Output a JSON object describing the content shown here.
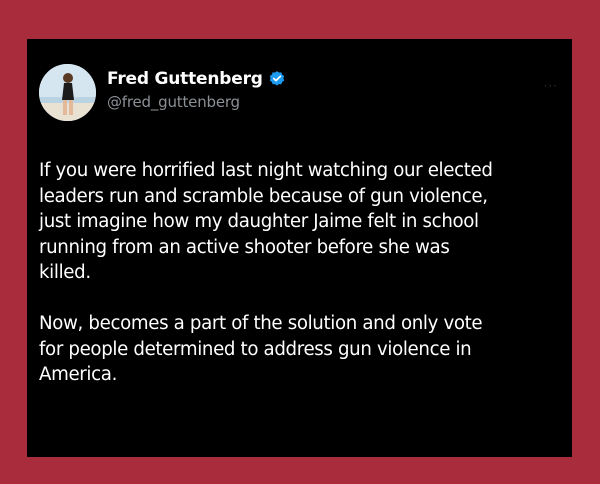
{
  "tweet": {
    "author": {
      "display_name": "Fred Guttenberg",
      "handle": "@fred_guttenberg",
      "verified": true
    },
    "paragraphs": [
      {
        "lines": [
          "If you were horrified last night watching our elected",
          "leaders run and scramble because of gun violence,",
          "just imagine how my daughter Jaime felt in school",
          "running from an active shooter before she was",
          "killed."
        ]
      },
      {
        "lines": [
          "Now, becomes a part of the solution and only vote",
          "for people determined to address gun violence in",
          "America."
        ]
      }
    ]
  },
  "colors": {
    "frame_background": "#a92c3c",
    "card_background": "#000000",
    "verified_badge": "#1d9bf0",
    "handle_text": "#8b9095"
  },
  "icons": {
    "verified": "verified-badge-icon",
    "more": "more-options-icon"
  }
}
